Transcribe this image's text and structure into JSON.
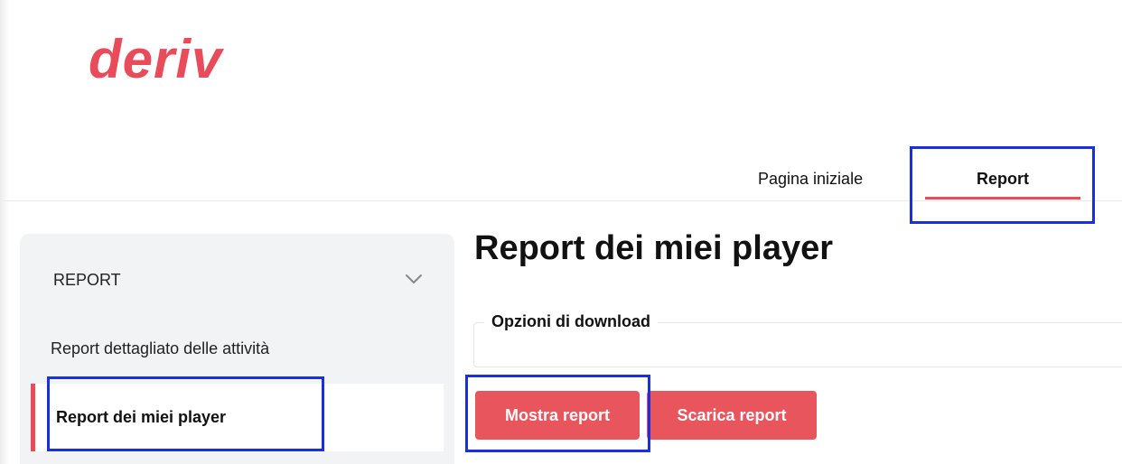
{
  "brand": {
    "logo_text": "deriv",
    "accent_color": "#e84c5a",
    "button_color": "#e8555d",
    "highlight_color": "#1a2fe0"
  },
  "top_nav": {
    "items": [
      {
        "label": "Pagina iniziale",
        "active": false
      },
      {
        "label": "Report",
        "active": true
      }
    ]
  },
  "sidebar": {
    "heading": "REPORT",
    "chevron_icon": "chevron-down-icon",
    "items": [
      {
        "label": "Report dettagliato delle attività",
        "active": false
      },
      {
        "label": "Report dei miei player",
        "active": true
      }
    ]
  },
  "main": {
    "title": "Report dei miei player",
    "download_options_label": "Opzioni di download",
    "buttons": {
      "show_report": "Mostra report",
      "download_report": "Scarica report"
    }
  }
}
